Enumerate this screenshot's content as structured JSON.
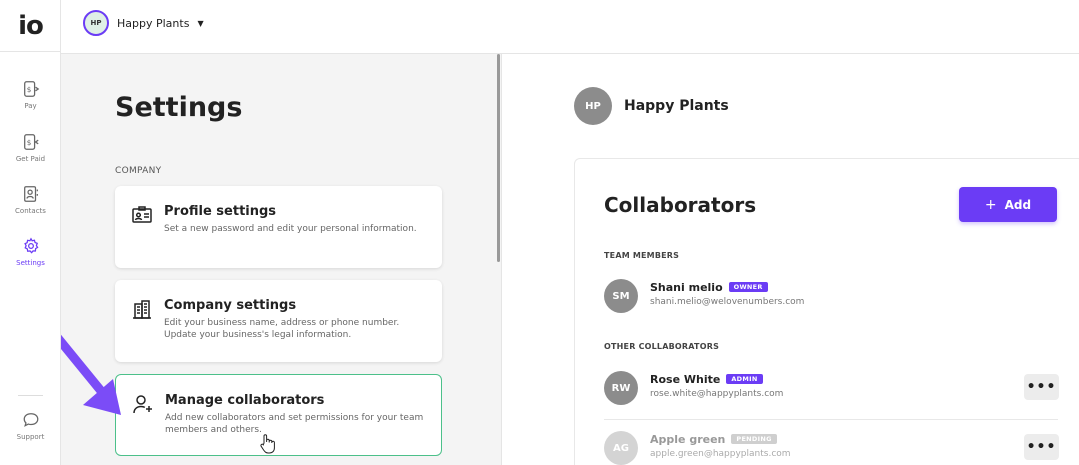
{
  "app": {
    "logo_text": "io"
  },
  "nav": {
    "items": [
      {
        "label": "Pay",
        "icon": "pay-icon"
      },
      {
        "label": "Get Paid",
        "icon": "get-paid-icon"
      },
      {
        "label": "Contacts",
        "icon": "contacts-icon"
      },
      {
        "label": "Settings",
        "icon": "gear-icon",
        "active": true
      }
    ],
    "support_label": "Support"
  },
  "topbar": {
    "org_initials": "HP",
    "org_name": "Happy Plants"
  },
  "settings": {
    "title": "Settings",
    "section_label": "COMPANY",
    "cards": [
      {
        "title": "Profile settings",
        "description": "Set a new password and edit your personal information."
      },
      {
        "title": "Company settings",
        "description": "Edit your business name, address or phone number. Update your business's legal information."
      },
      {
        "title": "Manage collaborators",
        "description": "Add new collaborators and set permissions for your team members and others."
      }
    ]
  },
  "org_header": {
    "initials": "HP",
    "name": "Happy Plants"
  },
  "collaborators": {
    "title": "Collaborators",
    "add_label": "Add",
    "team_label": "TEAM MEMBERS",
    "other_label": "OTHER COLLABORATORS",
    "team": [
      {
        "initials": "SM",
        "name": "Shani melio",
        "badge": "OWNER",
        "email": "shani.melio@welovenumbers.com"
      }
    ],
    "others": [
      {
        "initials": "RW",
        "name": "Rose White",
        "badge": "ADMIN",
        "email": "rose.white@happyplants.com"
      },
      {
        "initials": "AG",
        "name": "Apple green",
        "badge": "PENDING",
        "email": "apple.green@happyplants.com"
      }
    ]
  },
  "colors": {
    "accent": "#6b3cf5",
    "selected_border": "#4cc08a",
    "arrow": "#7b4cf7"
  }
}
